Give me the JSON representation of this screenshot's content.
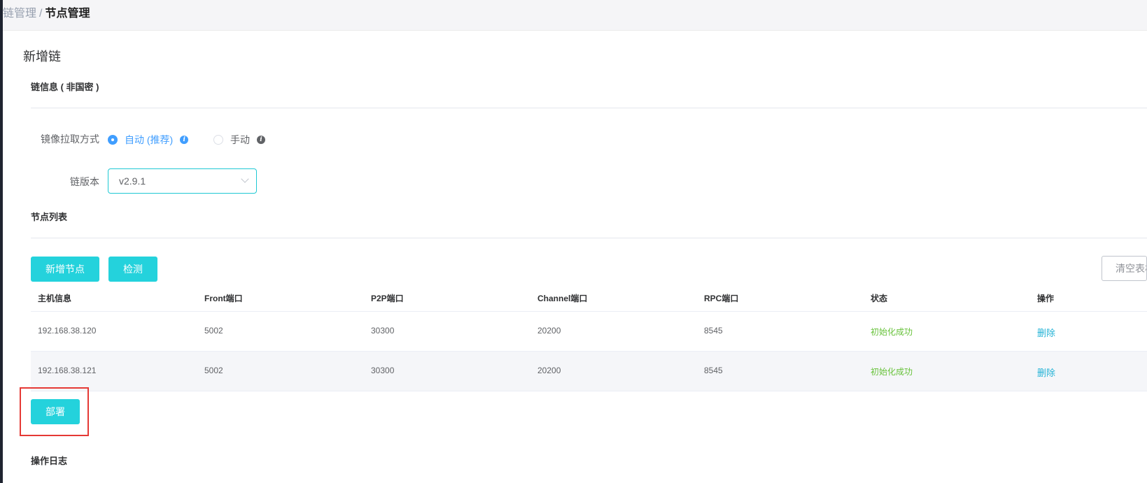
{
  "breadcrumb": {
    "prev": "链管理",
    "separator": "/",
    "current": "节点管理"
  },
  "card_title": "新增链",
  "chain_info": {
    "title": "链信息 ( 非国密 )",
    "pull_mode_label": "镜像拉取方式",
    "pull_options": [
      {
        "label": "自动 (推荐)",
        "checked": true
      },
      {
        "label": "手动",
        "checked": false
      }
    ],
    "version_label": "链版本",
    "version_value": "v2.9.1"
  },
  "node_list": {
    "title": "节点列表",
    "add_button": "新增节点",
    "check_button": "检测",
    "clear_button": "清空表格",
    "columns": [
      "主机信息",
      "Front端口",
      "P2P端口",
      "Channel端口",
      "RPC端口",
      "状态",
      "操作"
    ],
    "rows": [
      {
        "host": "192.168.38.120",
        "front": "5002",
        "p2p": "30300",
        "channel": "20200",
        "rpc": "8545",
        "status": "初始化成功",
        "action": "删除"
      },
      {
        "host": "192.168.38.121",
        "front": "5002",
        "p2p": "30300",
        "channel": "20200",
        "rpc": "8545",
        "status": "初始化成功",
        "action": "删除"
      }
    ]
  },
  "deploy_button": "部署",
  "log_title": "操作日志",
  "colors": {
    "accent": "#24d2dc",
    "success": "#67c23a",
    "link": "#24b3d6",
    "highlight": "#e53935"
  }
}
